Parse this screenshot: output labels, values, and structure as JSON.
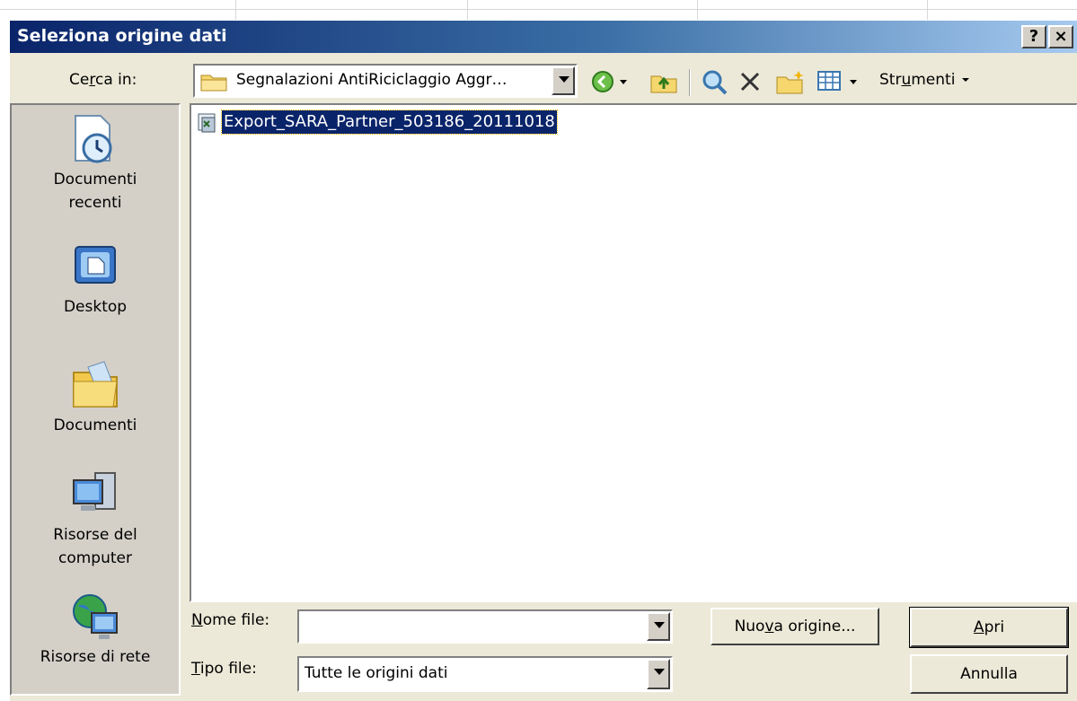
{
  "window": {
    "title": "Seleziona origine dati",
    "help_label": "?",
    "close_label": "×"
  },
  "lookin": {
    "label_pre": "Ce",
    "label_key": "r",
    "label_post": "ca in:",
    "value": "Segnalazioni AntiRiciclaggio Aggr…"
  },
  "toolbar": {
    "tools_label_pre": "Str",
    "tools_label_key": "u",
    "tools_label_post": "menti",
    "icons": [
      "back-icon",
      "up-folder-icon",
      "search-web-icon",
      "delete-icon",
      "new-folder-icon",
      "views-icon"
    ]
  },
  "places": [
    {
      "line1": "Documenti",
      "line2": "recenti",
      "icon": "recent-documents-icon"
    },
    {
      "line1": "Desktop",
      "line2": "",
      "icon": "desktop-icon"
    },
    {
      "line1": "Documenti",
      "line2": "",
      "icon": "my-documents-icon"
    },
    {
      "line1": "Risorse del",
      "line2": "computer",
      "icon": "my-computer-icon"
    },
    {
      "line1": "Risorse di rete",
      "line2": "",
      "icon": "network-icon"
    }
  ],
  "files": [
    {
      "name": "Export_SARA_Partner_503186_20111018",
      "icon": "data-source-file-icon",
      "selected": true
    }
  ],
  "form": {
    "filename_label_key": "N",
    "filename_label_rest": "ome file:",
    "filename_value": "",
    "filetype_label_key": "T",
    "filetype_label_rest": "ipo file:",
    "filetype_value": "Tutte le origini dati"
  },
  "buttons": {
    "new_source_pre": "Nuo",
    "new_source_key": "v",
    "new_source_post": "a origine...",
    "open_key": "A",
    "open_rest": "pri",
    "cancel": "Annulla"
  },
  "colors": {
    "title_start": "#0a246a",
    "title_end": "#a6caf0",
    "selection": "#0a246a",
    "dialog_bg": "#ece9d8"
  }
}
